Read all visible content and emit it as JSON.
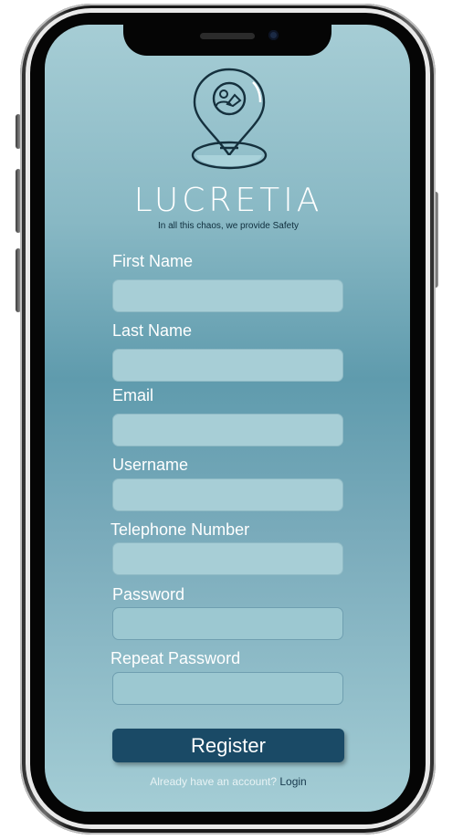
{
  "app": {
    "brand_name": "LUCRETIA",
    "tagline": "In all this chaos, we provide Safety"
  },
  "form": {
    "fields": [
      {
        "label": "First Name",
        "value": ""
      },
      {
        "label": "Last Name",
        "value": ""
      },
      {
        "label": "Email",
        "value": ""
      },
      {
        "label": "Username",
        "value": ""
      },
      {
        "label": "Telephone Number",
        "value": ""
      },
      {
        "label": "Password",
        "value": ""
      },
      {
        "label": "Repeat Password",
        "value": ""
      }
    ],
    "submit_label": "Register",
    "login_prompt": "Already have an account?",
    "login_link": "Login"
  },
  "icons": {
    "logo": "location-pin-with-people-icon"
  },
  "colors": {
    "background_top": "#a6cdd5",
    "background_mid": "#5f9bad",
    "input_fill": "#a7ced6",
    "button": "#1a4a66",
    "link": "#16384c",
    "label_text": "#ffffff"
  }
}
